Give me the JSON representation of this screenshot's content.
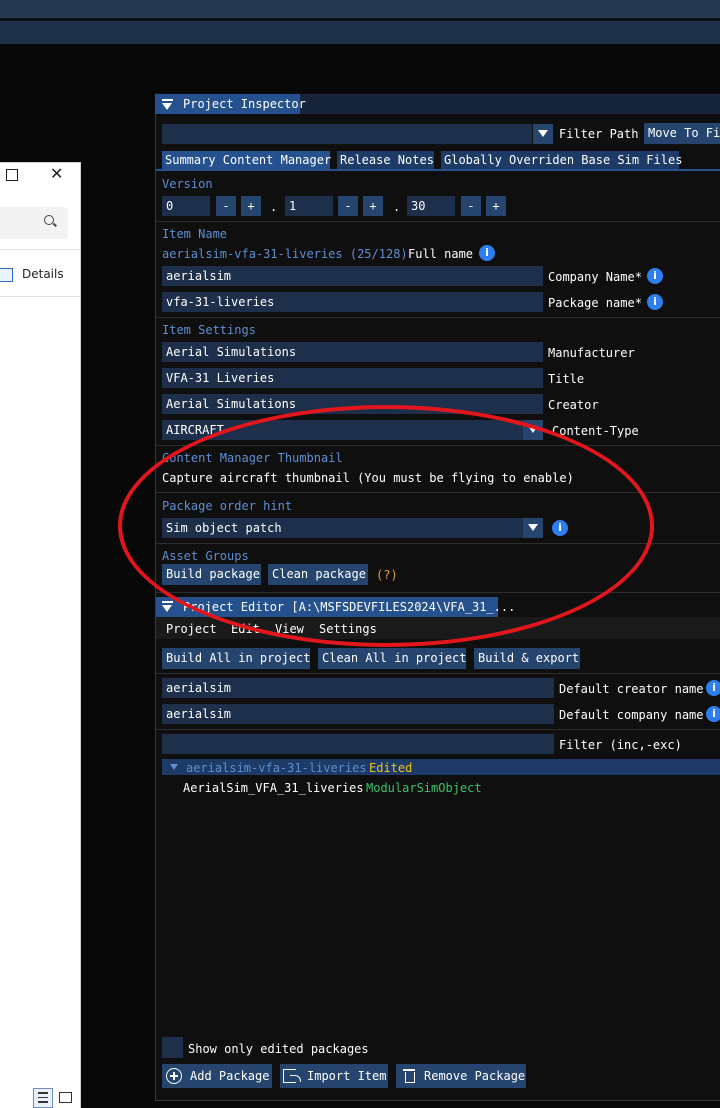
{
  "inspector": {
    "title": "Project Inspector",
    "filter_path_label": "Filter Path",
    "move_to_button": "Move To Fil",
    "tabs": [
      "Summary Content Manager",
      "Release Notes",
      "Globally Overriden Base Sim Files"
    ],
    "version_label": "Version",
    "version": {
      "major": "0",
      "minor": "1",
      "patch": "30"
    },
    "minus": "-",
    "plus": "+",
    "dot": ".",
    "item_name_label": "Item Name",
    "item_name_value": "aerialsim-vfa-31-liveries (25/128)",
    "full_name_label": "Full name",
    "company_name": "aerialsim",
    "company_name_label": "Company Name*",
    "package_name": "vfa-31-liveries",
    "package_name_label": "Package name*",
    "item_settings_label": "Item Settings",
    "manufacturer": "Aerial Simulations",
    "manufacturer_label": "Manufacturer",
    "title_value": "VFA-31 Liveries",
    "title_label": "Title",
    "creator": "Aerial Simulations",
    "creator_label": "Creator",
    "content_type": "AIRCRAFT",
    "content_type_label": "Content-Type",
    "thumbnail_label": "Content Manager Thumbnail",
    "thumbnail_text": "Capture aircraft thumbnail (You must be flying to enable)",
    "order_hint_label": "Package order hint",
    "order_hint_value": "Sim object patch",
    "asset_groups_label": "Asset Groups",
    "build_package": "Build package",
    "clean_package": "Clean package",
    "help": "(?)",
    "info_glyph": "i"
  },
  "editor": {
    "title": "Project Editor [A:\\MSFSDEVFILES2024\\VFA_31_...",
    "menu": [
      "Project",
      "Edit",
      "View",
      "Settings"
    ],
    "build_all": "Build All in project",
    "clean_all": "Clean All in project",
    "build_export": "Build & export",
    "creator_value": "aerialsim",
    "creator_label": "Default creator name",
    "company_value": "aerialsim",
    "company_label": "Default company name",
    "filter_label": "Filter (inc,-exc)",
    "tree_package": "aerialsim-vfa-31-liveries",
    "tree_package_status": "Edited",
    "tree_item": "AerialSim_VFA_31_liveries",
    "tree_item_type": "ModularSimObject",
    "show_edited": "Show only edited packages",
    "add_package": "Add Package",
    "import_item": "Import Item",
    "remove_package": "Remove Package"
  },
  "explorer": {
    "details": "Details",
    "close_glyph": "✕"
  },
  "colors": {
    "accent": "#25518e",
    "section": "#5e8fd3",
    "edited": "#f0c020",
    "type": "#3cc46a",
    "annotation": "#e3161e"
  }
}
